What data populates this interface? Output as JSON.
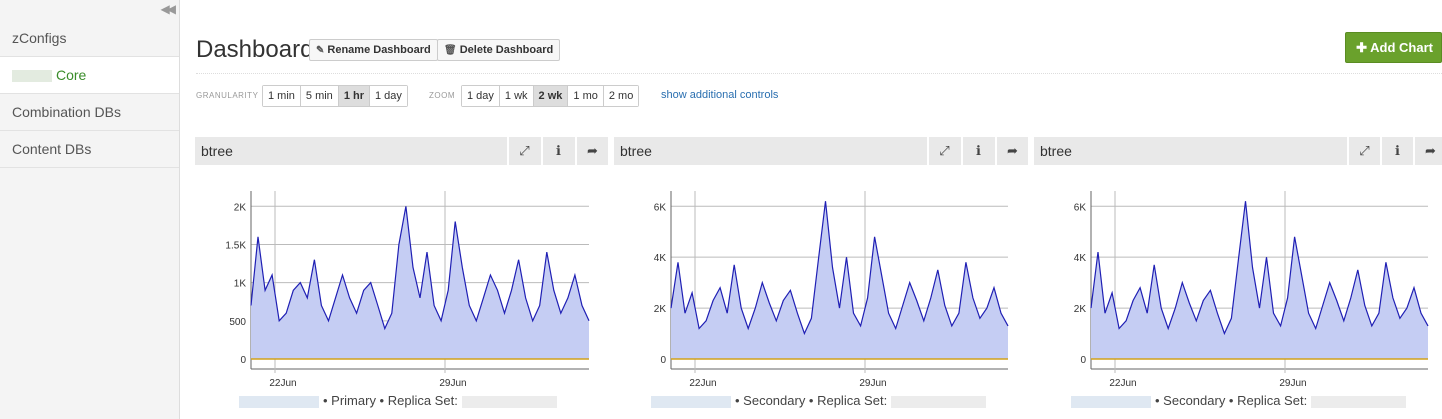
{
  "sidebar": {
    "items": [
      {
        "label": "zConfigs",
        "active": false
      },
      {
        "label": "Core",
        "active": true
      },
      {
        "label": "Combination DBs",
        "active": false
      },
      {
        "label": "Content DBs",
        "active": false
      }
    ]
  },
  "header": {
    "title": "Dashboard",
    "rename_label": "Rename Dashboard",
    "delete_label": "Delete Dashboard",
    "add_chart_label": "Add Chart"
  },
  "controls": {
    "granularity_label": "GRANULARITY",
    "granularity_options": [
      "1 min",
      "5 min",
      "1 hr",
      "1 day"
    ],
    "granularity_selected": "1 hr",
    "zoom_label": "ZOOM",
    "zoom_options": [
      "1 day",
      "1 wk",
      "2 wk",
      "1 mo",
      "2 mo"
    ],
    "zoom_selected": "2 wk",
    "more_link": "show additional controls"
  },
  "colors": {
    "accent": "#6aa12c",
    "series_line": "#1f1fb4",
    "series_fill": "#c5cdf3",
    "baseline": "#d2a21a",
    "link": "#2a6fb0"
  },
  "panels": [
    {
      "title": "btree",
      "role": "• Primary • Replica Set:",
      "x_ticks": [
        "22Jun",
        "29Jun"
      ]
    },
    {
      "title": "btree",
      "role": "• Secondary • Replica Set:",
      "x_ticks": [
        "22Jun",
        "29Jun"
      ]
    },
    {
      "title": "btree",
      "role": "• Secondary • Replica Set:",
      "x_ticks": [
        "22Jun",
        "29Jun"
      ]
    }
  ],
  "chart_data": [
    {
      "type": "area",
      "title": "btree",
      "x": [
        "22Jun",
        "29Jun"
      ],
      "y_ticks": [
        "0",
        "500",
        "1K",
        "1.5K",
        "2K"
      ],
      "ylim": [
        0,
        2200
      ],
      "series": [
        {
          "values": [
            700,
            1600,
            900,
            1100,
            500,
            600,
            900,
            1000,
            800,
            1300,
            700,
            500,
            800,
            1100,
            800,
            600,
            900,
            1000,
            700,
            400,
            600,
            1500,
            2000,
            1200,
            800,
            1400,
            700,
            500,
            900,
            1800,
            1200,
            700,
            500,
            800,
            1100,
            900,
            600,
            900,
            1300,
            800,
            500,
            700,
            1400,
            900,
            600,
            800,
            1100,
            700,
            500
          ]
        }
      ],
      "grid": true
    },
    {
      "type": "area",
      "title": "btree",
      "x": [
        "22Jun",
        "29Jun"
      ],
      "y_ticks": [
        "0",
        "2K",
        "4K",
        "6K"
      ],
      "ylim": [
        0,
        6600
      ],
      "series": [
        {
          "values": [
            2000,
            3800,
            1800,
            2600,
            1200,
            1500,
            2300,
            2800,
            1800,
            3700,
            2000,
            1200,
            2000,
            3000,
            2200,
            1500,
            2300,
            2700,
            1800,
            1000,
            1600,
            3900,
            6200,
            3600,
            2000,
            4000,
            1800,
            1300,
            2400,
            4800,
            3300,
            1800,
            1200,
            2100,
            3000,
            2300,
            1500,
            2400,
            3500,
            2100,
            1300,
            1800,
            3800,
            2400,
            1600,
            2000,
            2800,
            1800,
            1300
          ]
        }
      ],
      "grid": true
    },
    {
      "type": "area",
      "title": "btree",
      "x": [
        "22Jun",
        "29Jun"
      ],
      "y_ticks": [
        "0",
        "2K",
        "4K",
        "6K"
      ],
      "ylim": [
        0,
        6600
      ],
      "series": [
        {
          "values": [
            2000,
            4200,
            1800,
            2600,
            1200,
            1500,
            2300,
            2800,
            1800,
            3700,
            2000,
            1200,
            2000,
            3000,
            2200,
            1500,
            2300,
            2700,
            1800,
            1000,
            1600,
            3900,
            6200,
            3600,
            2000,
            4000,
            1800,
            1300,
            2400,
            4800,
            3300,
            1800,
            1200,
            2100,
            3000,
            2300,
            1500,
            2400,
            3500,
            2100,
            1300,
            1800,
            3800,
            2400,
            1600,
            2000,
            2800,
            1800,
            1300
          ]
        }
      ],
      "grid": true
    }
  ]
}
